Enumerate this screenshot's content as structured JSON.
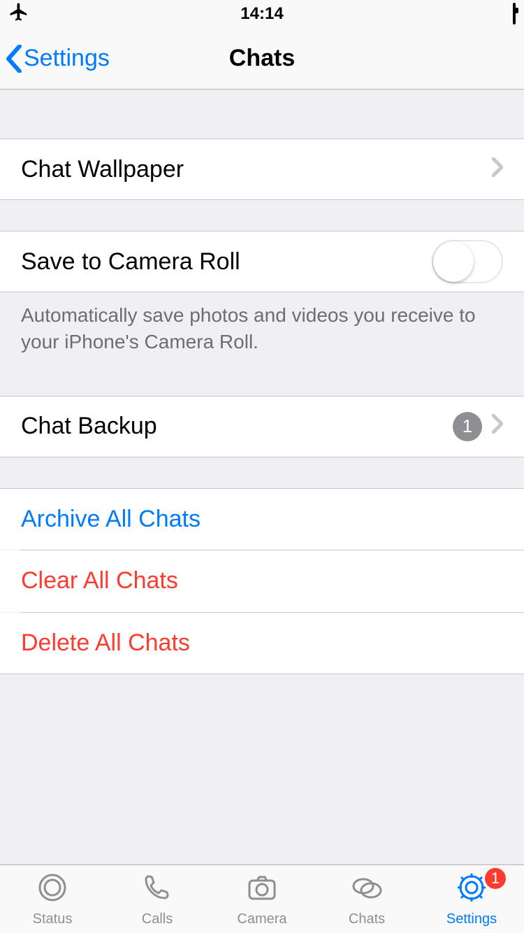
{
  "statusBar": {
    "time": "14:14"
  },
  "nav": {
    "back": "Settings",
    "title": "Chats"
  },
  "rows": {
    "wallpaper": "Chat Wallpaper",
    "saveCameraRoll": "Save to Camera Roll",
    "saveCameraRollNote": "Automatically save photos and videos you receive to your iPhone's Camera Roll.",
    "chatBackup": "Chat Backup",
    "chatBackupBadge": "1",
    "archiveAll": "Archive All Chats",
    "clearAll": "Clear All Chats",
    "deleteAll": "Delete All Chats"
  },
  "tabs": {
    "status": "Status",
    "calls": "Calls",
    "camera": "Camera",
    "chats": "Chats",
    "settings": "Settings",
    "settingsBadge": "1"
  }
}
